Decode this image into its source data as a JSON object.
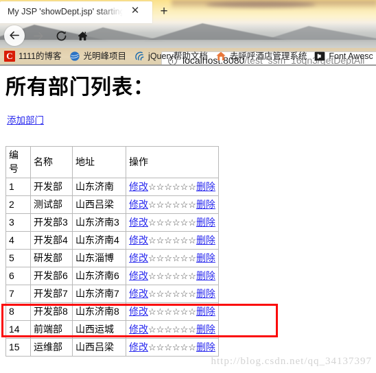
{
  "browser": {
    "tab": {
      "title": "My JSP 'showDept.jsp' starting p",
      "close_label": "✕"
    },
    "new_tab_label": "+",
    "nav": {
      "back_name": "back",
      "forward_name": "forward",
      "reload_name": "reload",
      "home_name": "home"
    },
    "omnibox": {
      "host": "localhost:8080",
      "path": "/test_ssm_16qn3/getDeptAll",
      "info_icon": "info-icon"
    },
    "bookmarks": [
      {
        "label": "1111的博客",
        "icon": "csdn-icon"
      },
      {
        "label": "光明峰项目",
        "icon": "globe-icon"
      },
      {
        "label": "jQuery帮助文档",
        "icon": "jquery-icon"
      },
      {
        "label": "去呼呼酒店管理系统",
        "icon": "house-icon"
      },
      {
        "label": "Font Awesc",
        "icon": "flag-icon"
      }
    ]
  },
  "page": {
    "title": "所有部门列表：",
    "add_link": "添加部门",
    "table": {
      "headers": [
        "编号",
        "名称",
        "地址",
        "操作"
      ],
      "op_edit": "修改",
      "op_stars": "☆☆☆☆☆☆",
      "op_delete": "删除",
      "rows": [
        {
          "id": "1",
          "name": "开发部",
          "addr": "山东济南"
        },
        {
          "id": "2",
          "name": "测试部",
          "addr": "山西吕梁"
        },
        {
          "id": "3",
          "name": "开发部3",
          "addr": "山东济南3"
        },
        {
          "id": "4",
          "name": "开发部4",
          "addr": "山东济南4"
        },
        {
          "id": "5",
          "name": "研发部",
          "addr": "山东淄博"
        },
        {
          "id": "6",
          "name": "开发部6",
          "addr": "山东济南6"
        },
        {
          "id": "7",
          "name": "开发部7",
          "addr": "山东济南7"
        },
        {
          "id": "8",
          "name": "开发部8",
          "addr": "山东济南8"
        },
        {
          "id": "14",
          "name": "前端部",
          "addr": "山西运城"
        },
        {
          "id": "15",
          "name": "运维部",
          "addr": "山西吕梁"
        }
      ]
    },
    "watermark": "http://blog.csdn.net/qq_34137397",
    "highlight_color": "#fb0a0a"
  }
}
